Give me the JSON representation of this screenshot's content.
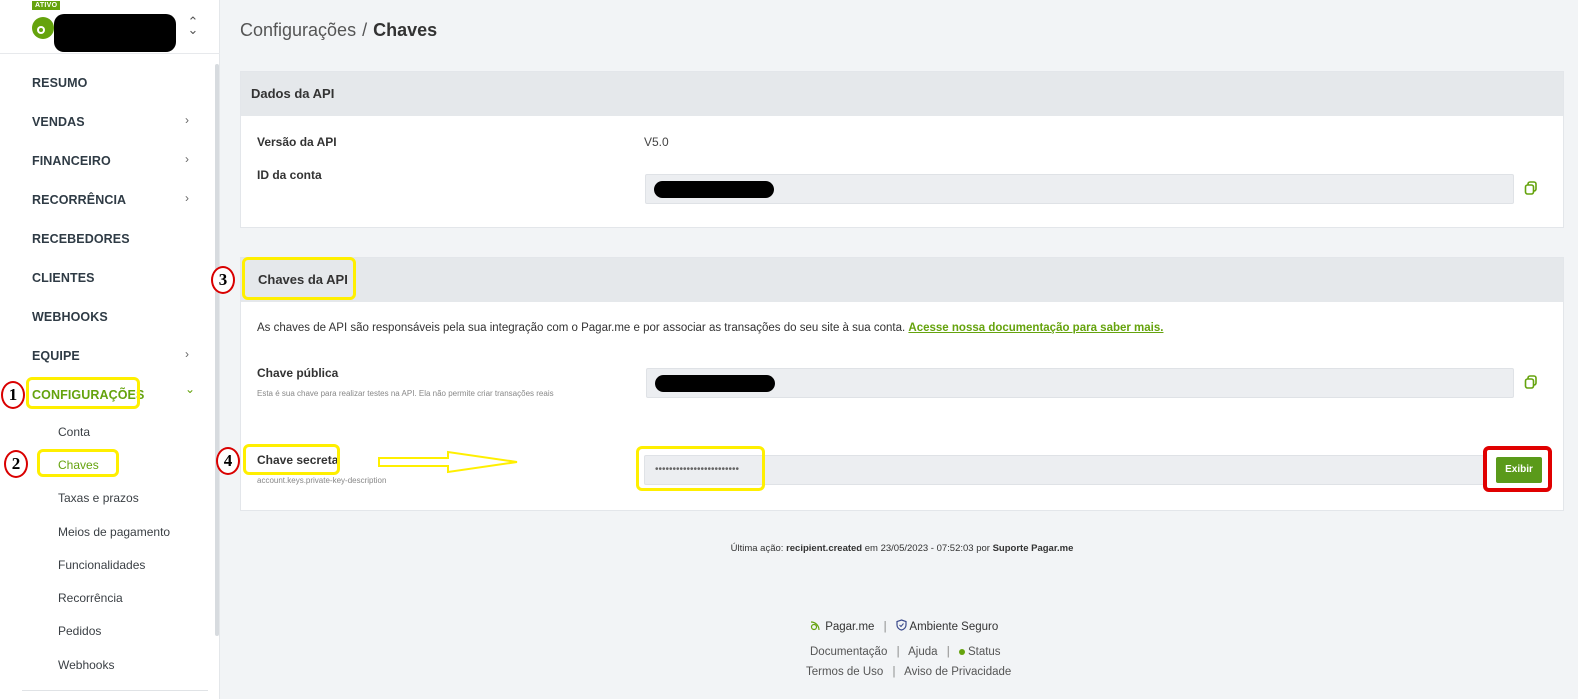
{
  "brand": {
    "badge": "ATIVO",
    "switch_icon": "chevron-up-down-icon"
  },
  "sidebar": {
    "items": [
      {
        "label": "RESUMO",
        "chevron": false
      },
      {
        "label": "VENDAS",
        "chevron": true
      },
      {
        "label": "FINANCEIRO",
        "chevron": true
      },
      {
        "label": "RECORRÊNCIA",
        "chevron": true
      },
      {
        "label": "RECEBEDORES",
        "chevron": false
      },
      {
        "label": "CLIENTES",
        "chevron": false
      },
      {
        "label": "WEBHOOKS",
        "chevron": false
      },
      {
        "label": "EQUIPE",
        "chevron": true
      },
      {
        "label": "CONFIGURAÇÕES",
        "chevron": true,
        "expanded": true,
        "active": true
      }
    ],
    "chevron_right": "›",
    "chevron_down": "⌄",
    "subitems": [
      {
        "label": "Conta"
      },
      {
        "label": "Chaves",
        "active": true
      },
      {
        "label": "Taxas e prazos"
      },
      {
        "label": "Meios de pagamento"
      },
      {
        "label": "Funcionalidades"
      },
      {
        "label": "Recorrência"
      },
      {
        "label": "Pedidos"
      },
      {
        "label": "Webhooks"
      }
    ]
  },
  "breadcrumb": {
    "parent": "Configurações",
    "separator": "/",
    "current": "Chaves"
  },
  "api_data_card": {
    "title": "Dados da API",
    "version_label": "Versão da API",
    "version_value": "V5.0",
    "account_id_label": "ID da conta"
  },
  "api_keys_card": {
    "title": "Chaves da API",
    "description": "As chaves de API são responsáveis pela sua integração com o Pagar.me e por associar as transações do seu site à sua conta.",
    "doc_link": "Acesse nossa documentação para saber mais.",
    "public_key_label": "Chave pública",
    "public_key_hint": "Esta é sua chave para realizar testes na API. Ela não permite criar transações reais",
    "secret_key_label": "Chave secreta",
    "secret_key_hint": "account.keys.private-key-description",
    "secret_key_mask": "••••••••••••••••••••••••",
    "show_button": "Exibir"
  },
  "annotations": [
    "1",
    "2",
    "3",
    "4"
  ],
  "last_action": {
    "prefix": "Última ação:",
    "action": "recipient.created",
    "middle": "em 23/05/2023 - 07:52:03 por",
    "user": "Suporte Pagar.me"
  },
  "footer": {
    "brand": "Pagar.me",
    "secure": "Ambiente Seguro",
    "documentation": "Documentação",
    "help": "Ajuda",
    "status": "Status",
    "terms": "Termos de Uso",
    "privacy": "Aviso de Privacidade",
    "divider": "|"
  },
  "colors": {
    "accent": "#65a30d",
    "highlight": "#ffef00",
    "annotation_red": "#e00000"
  }
}
